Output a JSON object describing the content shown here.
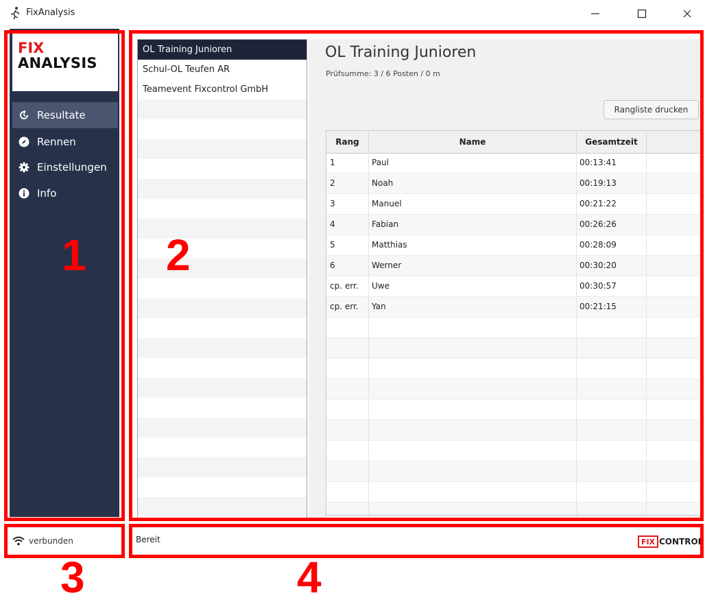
{
  "window": {
    "title": "FixAnalysis",
    "controls": {
      "minimize": "—",
      "maximize": "☐",
      "close": "✕"
    }
  },
  "sidebar": {
    "logo_top": "FIX",
    "logo_bottom": "ANALYSIS",
    "items": [
      {
        "label": "Resultate",
        "icon": "history-icon",
        "active": true
      },
      {
        "label": "Rennen",
        "icon": "compass-icon",
        "active": false
      },
      {
        "label": "Einstellungen",
        "icon": "gear-icon",
        "active": false
      },
      {
        "label": "Info",
        "icon": "info-icon",
        "active": false
      }
    ]
  },
  "races": [
    {
      "name": "OL Training Junioren",
      "selected": true
    },
    {
      "name": "Schul-OL Teufen AR",
      "selected": false
    },
    {
      "name": "Teamevent Fixcontrol GmbH",
      "selected": false
    }
  ],
  "detail": {
    "title": "OL Training Junioren",
    "subtitle": "Prüfsumme: 3 / 6 Posten / 0 m",
    "print_button": "Rangliste drucken",
    "table": {
      "headers": {
        "rang": "Rang",
        "name": "Name",
        "zeit": "Gesamtzeit"
      },
      "rows": [
        {
          "rang": "1",
          "name": "Paul",
          "zeit": "00:13:41"
        },
        {
          "rang": "2",
          "name": "Noah",
          "zeit": "00:19:13"
        },
        {
          "rang": "3",
          "name": "Manuel",
          "zeit": "00:21:22"
        },
        {
          "rang": "4",
          "name": "Fabian",
          "zeit": "00:26:26"
        },
        {
          "rang": "5",
          "name": "Matthias",
          "zeit": "00:28:09"
        },
        {
          "rang": "6",
          "name": "Werner",
          "zeit": "00:30:20"
        },
        {
          "rang": "cp. err.",
          "name": "Uwe",
          "zeit": "00:30:57"
        },
        {
          "rang": "cp. err.",
          "name": "Yan",
          "zeit": "00:21:15"
        }
      ]
    }
  },
  "statusbar": {
    "connection": "verbunden",
    "connection_icon": "wifi-icon",
    "status": "Bereit",
    "brand_fix": "FIX",
    "brand_control": "CONTROL"
  },
  "annotations": {
    "n1": "1",
    "n2": "2",
    "n3": "3",
    "n4": "4"
  },
  "colors": {
    "sidebar": "#27324a",
    "sidebar_active": "#4a5570",
    "selected_row": "#1e2538",
    "accent_red": "#e2191c",
    "annotation_red": "#ff0000"
  }
}
